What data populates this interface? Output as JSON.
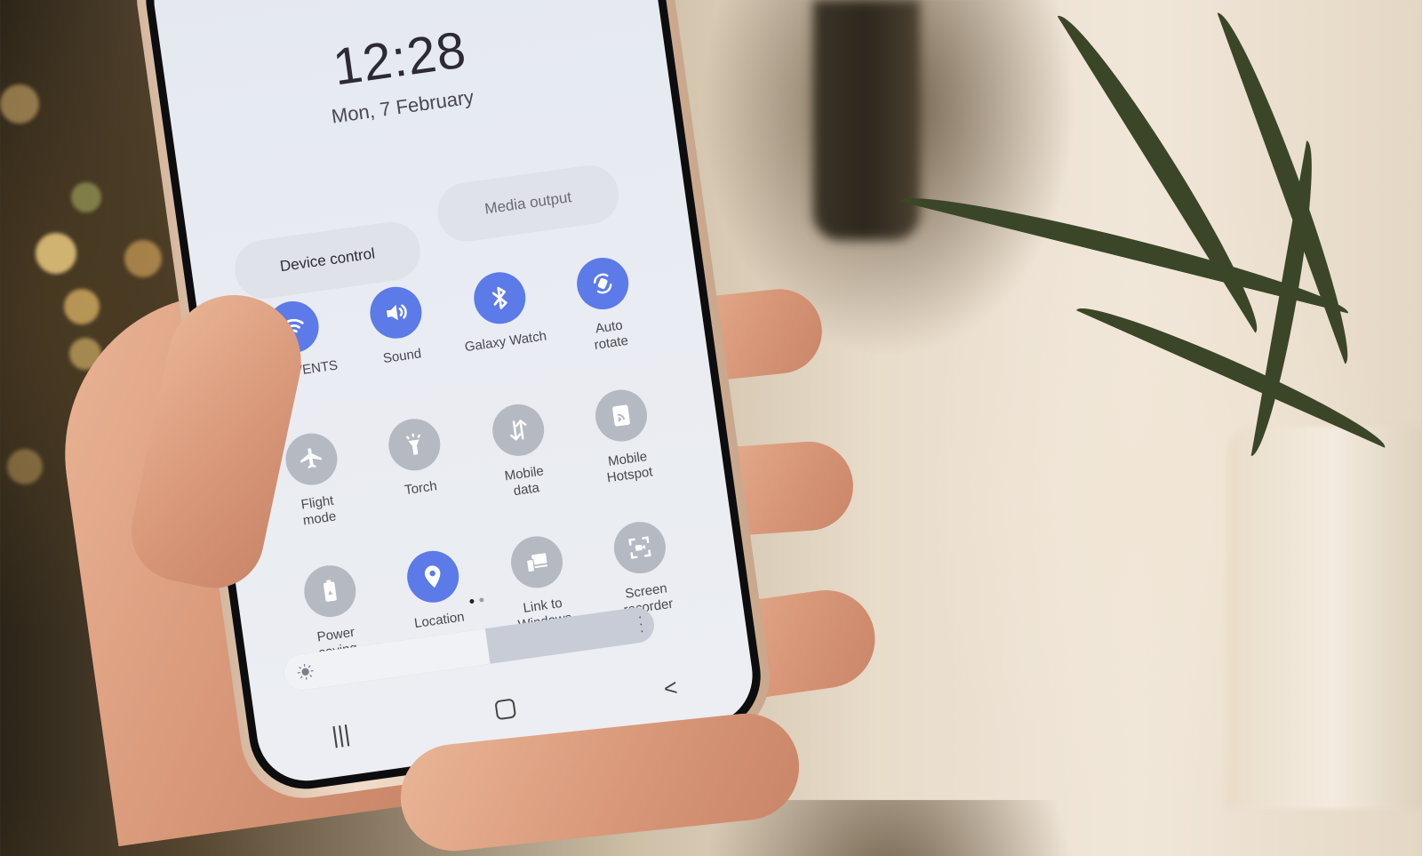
{
  "lock_screen": {
    "time": "12:28",
    "date": "Mon, 7 February"
  },
  "quick_panel": {
    "buttons": [
      {
        "label": "Device control"
      },
      {
        "label": "Media output"
      }
    ],
    "tiles": [
      {
        "label": "KX_EVENTS",
        "icon": "wifi-icon",
        "state": "on"
      },
      {
        "label": "Sound",
        "icon": "volume-icon",
        "state": "on"
      },
      {
        "label": "Galaxy Watch",
        "icon": "bluetooth-icon",
        "state": "on"
      },
      {
        "label": "Auto\nrotate",
        "icon": "auto-rotate-icon",
        "state": "on"
      },
      {
        "label": "Flight\nmode",
        "icon": "airplane-icon",
        "state": "off"
      },
      {
        "label": "Torch",
        "icon": "flashlight-icon",
        "state": "off"
      },
      {
        "label": "Mobile\ndata",
        "icon": "mobile-data-icon",
        "state": "off"
      },
      {
        "label": "Mobile\nHotspot",
        "icon": "hotspot-icon",
        "state": "off"
      },
      {
        "label": "Power\nsaving",
        "icon": "battery-saver-icon",
        "state": "off"
      },
      {
        "label": "Location",
        "icon": "location-icon",
        "state": "on"
      },
      {
        "label": "Link to\nWindows",
        "icon": "link-devices-icon",
        "state": "off"
      },
      {
        "label": "Screen\nrecorder",
        "icon": "screen-record-icon",
        "state": "off"
      }
    ],
    "page_indicator": {
      "current": 1,
      "total": 2
    },
    "brightness": {
      "level_percent": 55
    },
    "colors": {
      "active": "#5c7ae8",
      "inactive": "#b5b9c2"
    }
  },
  "navigation": {
    "recents": "|||",
    "back": "<"
  }
}
